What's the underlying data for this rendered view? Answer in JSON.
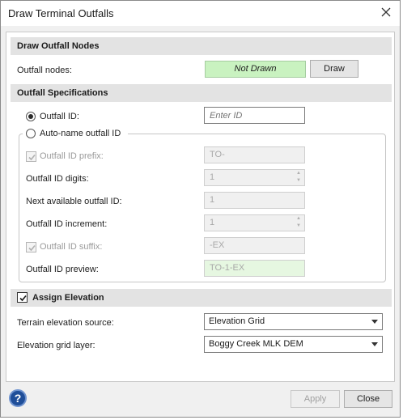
{
  "window": {
    "title": "Draw Terminal Outfalls",
    "close_icon": "close-icon"
  },
  "draw_nodes": {
    "header": "Draw Outfall Nodes",
    "nodes_label": "Outfall nodes:",
    "status": "Not Drawn",
    "draw_button": "Draw",
    "status_color": "#c9f2c0"
  },
  "specs": {
    "header": "Outfall Specifications",
    "outfall_id_radio_label": "Outfall ID:",
    "outfall_id_radio_selected": true,
    "outfall_id_placeholder": "Enter ID",
    "auto_name_radio_label": "Auto-name outfall ID",
    "auto_name_radio_selected": false,
    "prefix_label": "Outfall ID prefix:",
    "prefix_checked": true,
    "prefix_value": "TO-",
    "digits_label": "Outfall ID digits:",
    "digits_value": "1",
    "next_label": "Next available outfall ID:",
    "next_value": "1",
    "increment_label": "Outfall ID increment:",
    "increment_value": "1",
    "suffix_label": "Outfall ID suffix:",
    "suffix_checked": true,
    "suffix_value": "-EX",
    "preview_label": "Outfall ID preview:",
    "preview_value": "TO-1-EX"
  },
  "elevation": {
    "header": "Assign Elevation",
    "assign_checked": true,
    "source_label": "Terrain elevation source:",
    "source_value": "Elevation Grid",
    "grid_layer_label": "Elevation grid layer:",
    "grid_layer_value": "Boggy Creek MLK DEM"
  },
  "footer": {
    "help_icon": "help-icon",
    "help_glyph": "?",
    "apply_button": "Apply",
    "close_button": "Close"
  }
}
